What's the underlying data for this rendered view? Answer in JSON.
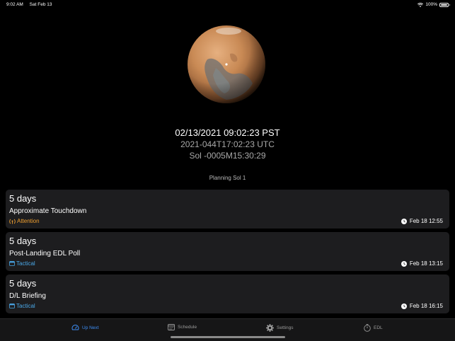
{
  "status_bar": {
    "time": "9:02 AM",
    "date": "Sat Feb 13",
    "battery": "100%"
  },
  "clock": {
    "local": "02/13/2021 09:02:23 PST",
    "utc": "2021-044T17:02:23 UTC",
    "sol": "Sol -0005M15:30:29"
  },
  "planning_sol": "Planning Sol 1",
  "events": [
    {
      "days": "5 days",
      "title": "Approximate Touchdown",
      "tag": "Attention",
      "tag_color": "#f0a030",
      "time": "Feb 18 12:55"
    },
    {
      "days": "5 days",
      "title": "Post-Landing EDL Poll",
      "tag": "Tactical",
      "tag_color": "#4aa8e8",
      "time": "Feb 18 13:15"
    },
    {
      "days": "5 days",
      "title": "D/L Briefing",
      "tag": "Tactical",
      "tag_color": "#4aa8e8",
      "time": "Feb 18 16:15"
    }
  ],
  "tabs": [
    {
      "label": "Up Next",
      "icon": "gauge-icon",
      "active": true
    },
    {
      "label": "Schedule",
      "icon": "calendar-icon",
      "active": false
    },
    {
      "label": "Settings",
      "icon": "gear-icon",
      "active": false
    },
    {
      "label": "EDL",
      "icon": "stopwatch-icon",
      "active": false
    }
  ],
  "colors": {
    "accent": "#3d8ef5",
    "card_bg": "#1d1d1f",
    "attention": "#f0a030",
    "tactical": "#4aa8e8"
  }
}
